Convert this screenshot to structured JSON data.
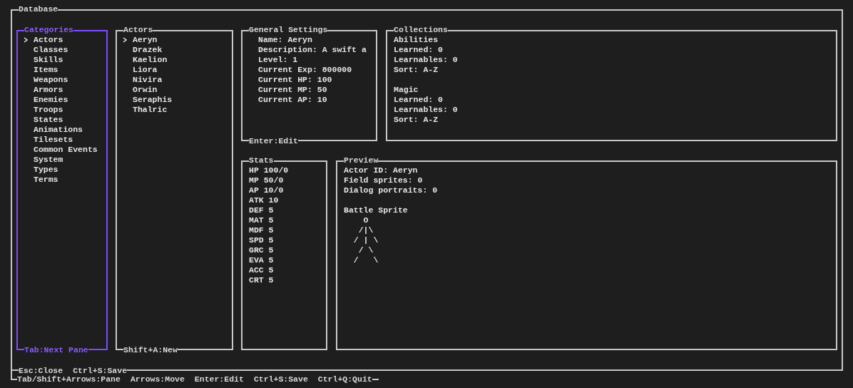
{
  "window": {
    "title": "Database",
    "footer": [
      "Esc:Close",
      "Ctrl+S:Save"
    ]
  },
  "categories": {
    "title": "Categories",
    "footer": "Tab:Next Pane",
    "focused": true,
    "items": [
      {
        "label": "Actors",
        "selected": true
      },
      {
        "label": "Classes",
        "selected": false
      },
      {
        "label": "Skills",
        "selected": false
      },
      {
        "label": "Items",
        "selected": false
      },
      {
        "label": "Weapons",
        "selected": false
      },
      {
        "label": "Armors",
        "selected": false
      },
      {
        "label": "Enemies",
        "selected": false
      },
      {
        "label": "Troops",
        "selected": false
      },
      {
        "label": "States",
        "selected": false
      },
      {
        "label": "Animations",
        "selected": false
      },
      {
        "label": "Tilesets",
        "selected": false
      },
      {
        "label": "Common Events",
        "selected": false
      },
      {
        "label": "System",
        "selected": false
      },
      {
        "label": "Types",
        "selected": false
      },
      {
        "label": "Terms",
        "selected": false
      }
    ]
  },
  "actors": {
    "title": "Actors",
    "footer": "Shift+A:New",
    "focused": false,
    "items": [
      {
        "label": "Aeryn",
        "selected": true
      },
      {
        "label": "Drazek",
        "selected": false
      },
      {
        "label": "Kaelion",
        "selected": false
      },
      {
        "label": "Liora",
        "selected": false
      },
      {
        "label": "Nivira",
        "selected": false
      },
      {
        "label": "Orwin",
        "selected": false
      },
      {
        "label": "Seraphis",
        "selected": false
      },
      {
        "label": "Thalric",
        "selected": false
      }
    ]
  },
  "general_settings": {
    "title": "General Settings",
    "footer": "Enter:Edit",
    "fields": [
      "Name: Aeryn",
      "Description: A swift a",
      "Level: 1",
      "Current Exp: 800000",
      "Current HP: 100",
      "Current MP: 50",
      "Current AP: 10"
    ]
  },
  "collections": {
    "title": "Collections",
    "groups": [
      {
        "heading": "Abilities",
        "lines": [
          "Learned: 0",
          "Learnables: 0",
          "Sort: A-Z"
        ]
      },
      {
        "heading": "Magic",
        "lines": [
          "Learned: 0",
          "Learnables: 0",
          "Sort: A-Z"
        ]
      }
    ]
  },
  "stats": {
    "title": "Stats",
    "lines": [
      "HP 100/0",
      "MP 50/0",
      "AP 10/0",
      "ATK 10",
      "DEF 5",
      "MAT 5",
      "MDF 5",
      "SPD 5",
      "GRC 5",
      "EVA 5",
      "ACC 5",
      "CRT 5"
    ]
  },
  "preview": {
    "title": "Preview",
    "lines": [
      "Actor ID: Aeryn",
      "Field sprites: 0",
      "Dialog portraits: 0"
    ],
    "sprite_heading": "Battle Sprite",
    "sprite": [
      "    O",
      "   /|\\",
      "  / | \\",
      "   / \\",
      "  /   \\"
    ]
  },
  "status_bar": [
    "Tab/Shift+Arrows:Pane",
    "Arrows:Move",
    "Enter:Edit",
    "Ctrl+S:Save",
    "Ctrl+Q:Quit"
  ]
}
